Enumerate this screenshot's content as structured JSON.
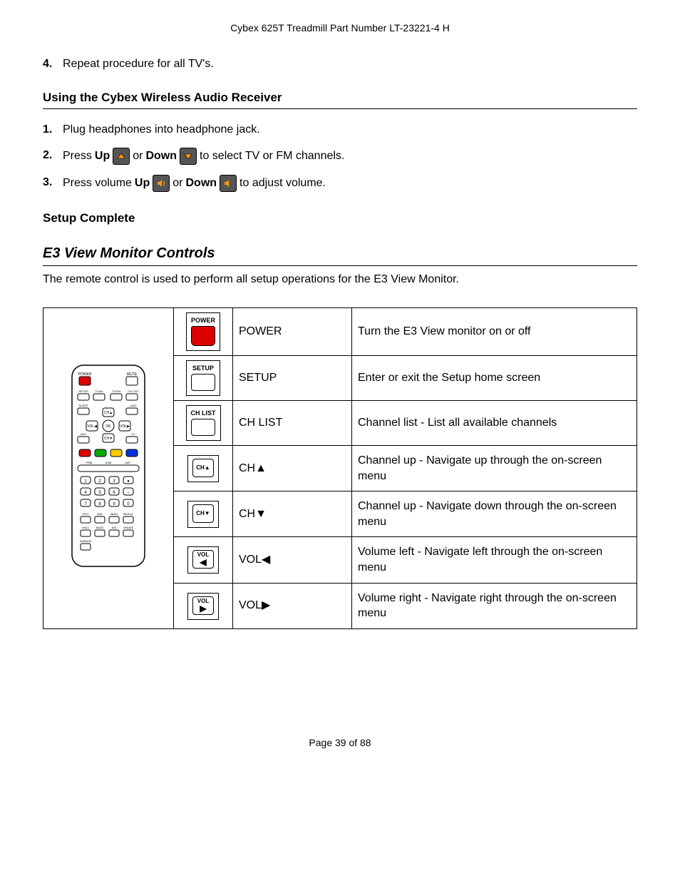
{
  "header": "Cybex 625T Treadmill Part Number LT-23221-4 H",
  "step4": {
    "num": "4.",
    "text": "Repeat procedure for all TV's."
  },
  "section1": "Using the Cybex Wireless Audio Receiver",
  "steps": {
    "s1": {
      "num": "1.",
      "text": "Plug headphones into headphone jack."
    },
    "s2": {
      "num": "2.",
      "pre": "Press ",
      "up": "Up",
      "mid": " or ",
      "down": "Down",
      "post": " to select TV or FM channels."
    },
    "s3": {
      "num": "3.",
      "pre": "Press volume ",
      "up": "Up",
      "mid": " or ",
      "down": "Down",
      "post": " to adjust volume."
    }
  },
  "section2": "Setup Complete",
  "section3": "E3 View Monitor Controls",
  "intro": "The remote control is used to perform all setup operations for the E3 View Monitor.",
  "rows": [
    {
      "iconLabel": "POWER",
      "label": "POWER",
      "desc": "Turn the E3 View monitor on or off"
    },
    {
      "iconLabel": "SETUP",
      "label": "SETUP",
      "desc": "Enter or exit the Setup home screen"
    },
    {
      "iconLabel": "CH LIST",
      "label": "CH LIST",
      "desc": "Channel list - List all available channels"
    },
    {
      "iconLabel": "CH▲",
      "label": "CH▲",
      "desc": "Channel up - Navigate up through the on-screen menu"
    },
    {
      "iconLabel": "CH▼",
      "label": "CH▼",
      "desc": "Channel up - Navigate down through the on-screen menu"
    },
    {
      "iconLabel": "VOL",
      "label": "VOL◀",
      "desc": "Volume left - Navigate left through the on-screen menu"
    },
    {
      "iconLabel": "VOL",
      "label": "VOL▶",
      "desc": "Volume right - Navigate right through the on-screen menu"
    }
  ],
  "footer": "Page 39 of 88"
}
